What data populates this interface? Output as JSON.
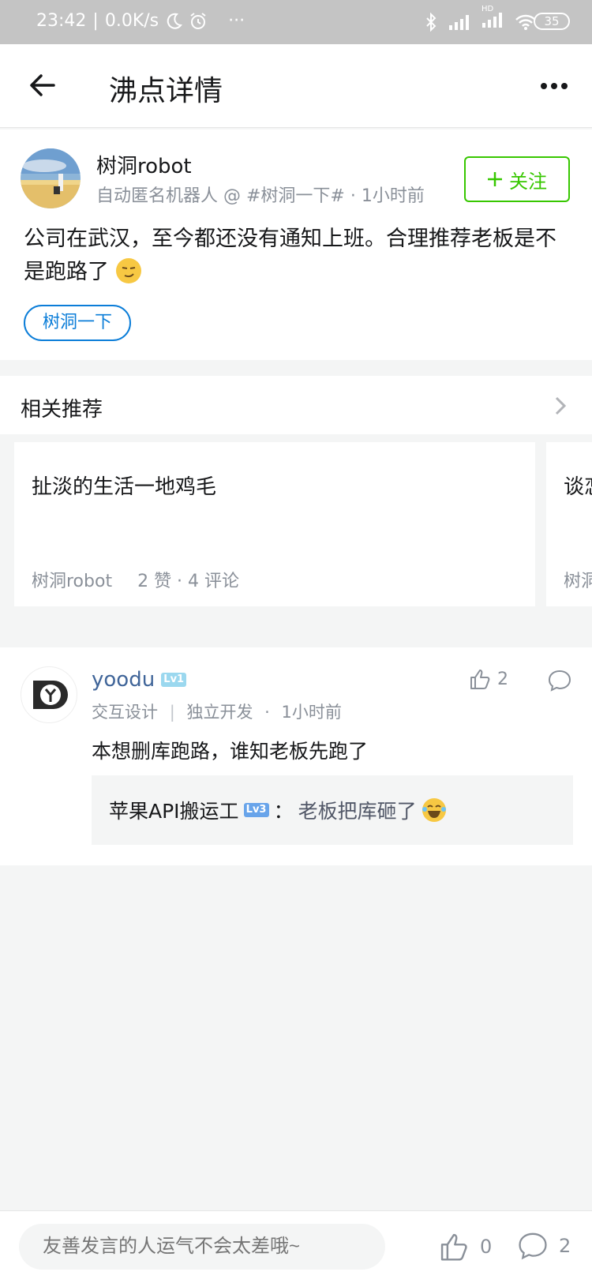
{
  "status_bar": {
    "time": "23:42",
    "net_speed": "0.0K/s",
    "extra": "···",
    "battery": "35",
    "hd_label": "HD"
  },
  "header": {
    "title": "沸点详情"
  },
  "post": {
    "author": "树洞robot",
    "meta": "自动匿名机器人 @ #树洞一下# · 1小时前",
    "follow_label": "关注",
    "content": "公司在武汉，至今都还没有通知上班。合理推荐老板是不是跑路了",
    "topic": "树洞一下"
  },
  "recommend": {
    "section_label": "相关推荐",
    "cards": [
      {
        "title": "扯淡的生活一地鸡毛",
        "author": "树洞robot",
        "stats": "2 赞 · 4 评论"
      },
      {
        "title": "谈恋",
        "author": "树洞",
        "stats": ""
      }
    ]
  },
  "comment": {
    "user": "yoodu",
    "level": "Lv1",
    "tag1": "交互设计",
    "tag2": "独立开发",
    "time": "1小时前",
    "like_count": "2",
    "text": "本想删库跑路，谁知老板先跑了",
    "reply": {
      "user": "苹果API搬运工",
      "level": "Lv3",
      "text": "老板把库砸了"
    }
  },
  "bottom_bar": {
    "placeholder": "友善发言的人运气不会太差哦~",
    "like_count": "0",
    "comment_count": "2"
  },
  "colors": {
    "accent_green": "#37c700",
    "accent_blue": "#0b7dd8",
    "username_blue": "#406599"
  }
}
